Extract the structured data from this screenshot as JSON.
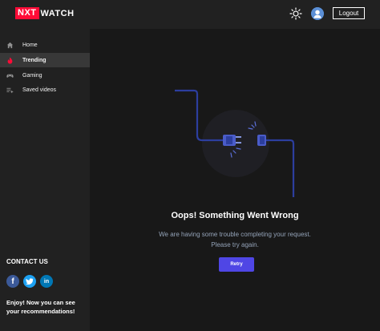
{
  "header": {
    "logo_part1": "NXT",
    "logo_part2": "WATCH",
    "logout_label": "Logout"
  },
  "sidebar": {
    "items": [
      {
        "label": "Home",
        "icon": "home-icon"
      },
      {
        "label": "Trending",
        "icon": "fire-icon",
        "active": true
      },
      {
        "label": "Gaming",
        "icon": "gamepad-icon"
      },
      {
        "label": "Saved videos",
        "icon": "playlist-add-icon"
      }
    ],
    "contact_title": "CONTACT US",
    "social": [
      {
        "icon": "facebook-icon"
      },
      {
        "icon": "twitter-icon"
      },
      {
        "icon": "linkedin-icon"
      }
    ],
    "recommend_text": "Enjoy! Now you can see your recommendations!"
  },
  "main": {
    "title": "Oops! Something Went Wrong",
    "desc_line1": "We are having some trouble completing your request.",
    "desc_line2": "Please try again.",
    "retry_label": "Retry"
  },
  "colors": {
    "brand": "#ff0b37",
    "accent": "#4f46e5",
    "background": "#181818",
    "sidebar_bg": "#212121",
    "active_item_bg": "#383838",
    "cable": "#2c3e9e"
  }
}
